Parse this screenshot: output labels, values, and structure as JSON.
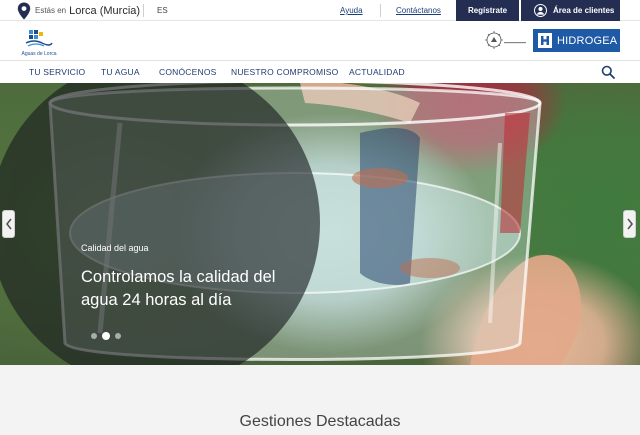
{
  "topbar": {
    "location_prefix": "Estás en",
    "location_city": "Lorca (Murcia)",
    "language": "ES",
    "help_link": "Ayuda",
    "contact_link": "Contáctanos",
    "register_button": "Regístrate",
    "client_area_button": "Área de clientes",
    "icons": [
      "location-pin-icon",
      "user-icon"
    ]
  },
  "header": {
    "logo_text": "Aguas de Lorca",
    "partner_brand": "HIDROGEA",
    "colors": {
      "brand_navy": "#232e52",
      "hidrogea_blue": "#1f5aa6"
    }
  },
  "nav": {
    "items": [
      {
        "label": "TU SERVICIO"
      },
      {
        "label": "TU AGUA"
      },
      {
        "label": "CONÓCENOS"
      },
      {
        "label": "NUESTRO COMPROMISO"
      },
      {
        "label": "ACTUALIDAD"
      }
    ],
    "search_icon": "search-icon"
  },
  "hero": {
    "kicker": "Calidad del agua",
    "title": "Controlamos la calidad del agua 24 horas al día",
    "slide_count": 3,
    "active_slide": 2
  },
  "section": {
    "title": "Gestiones Destacadas"
  }
}
